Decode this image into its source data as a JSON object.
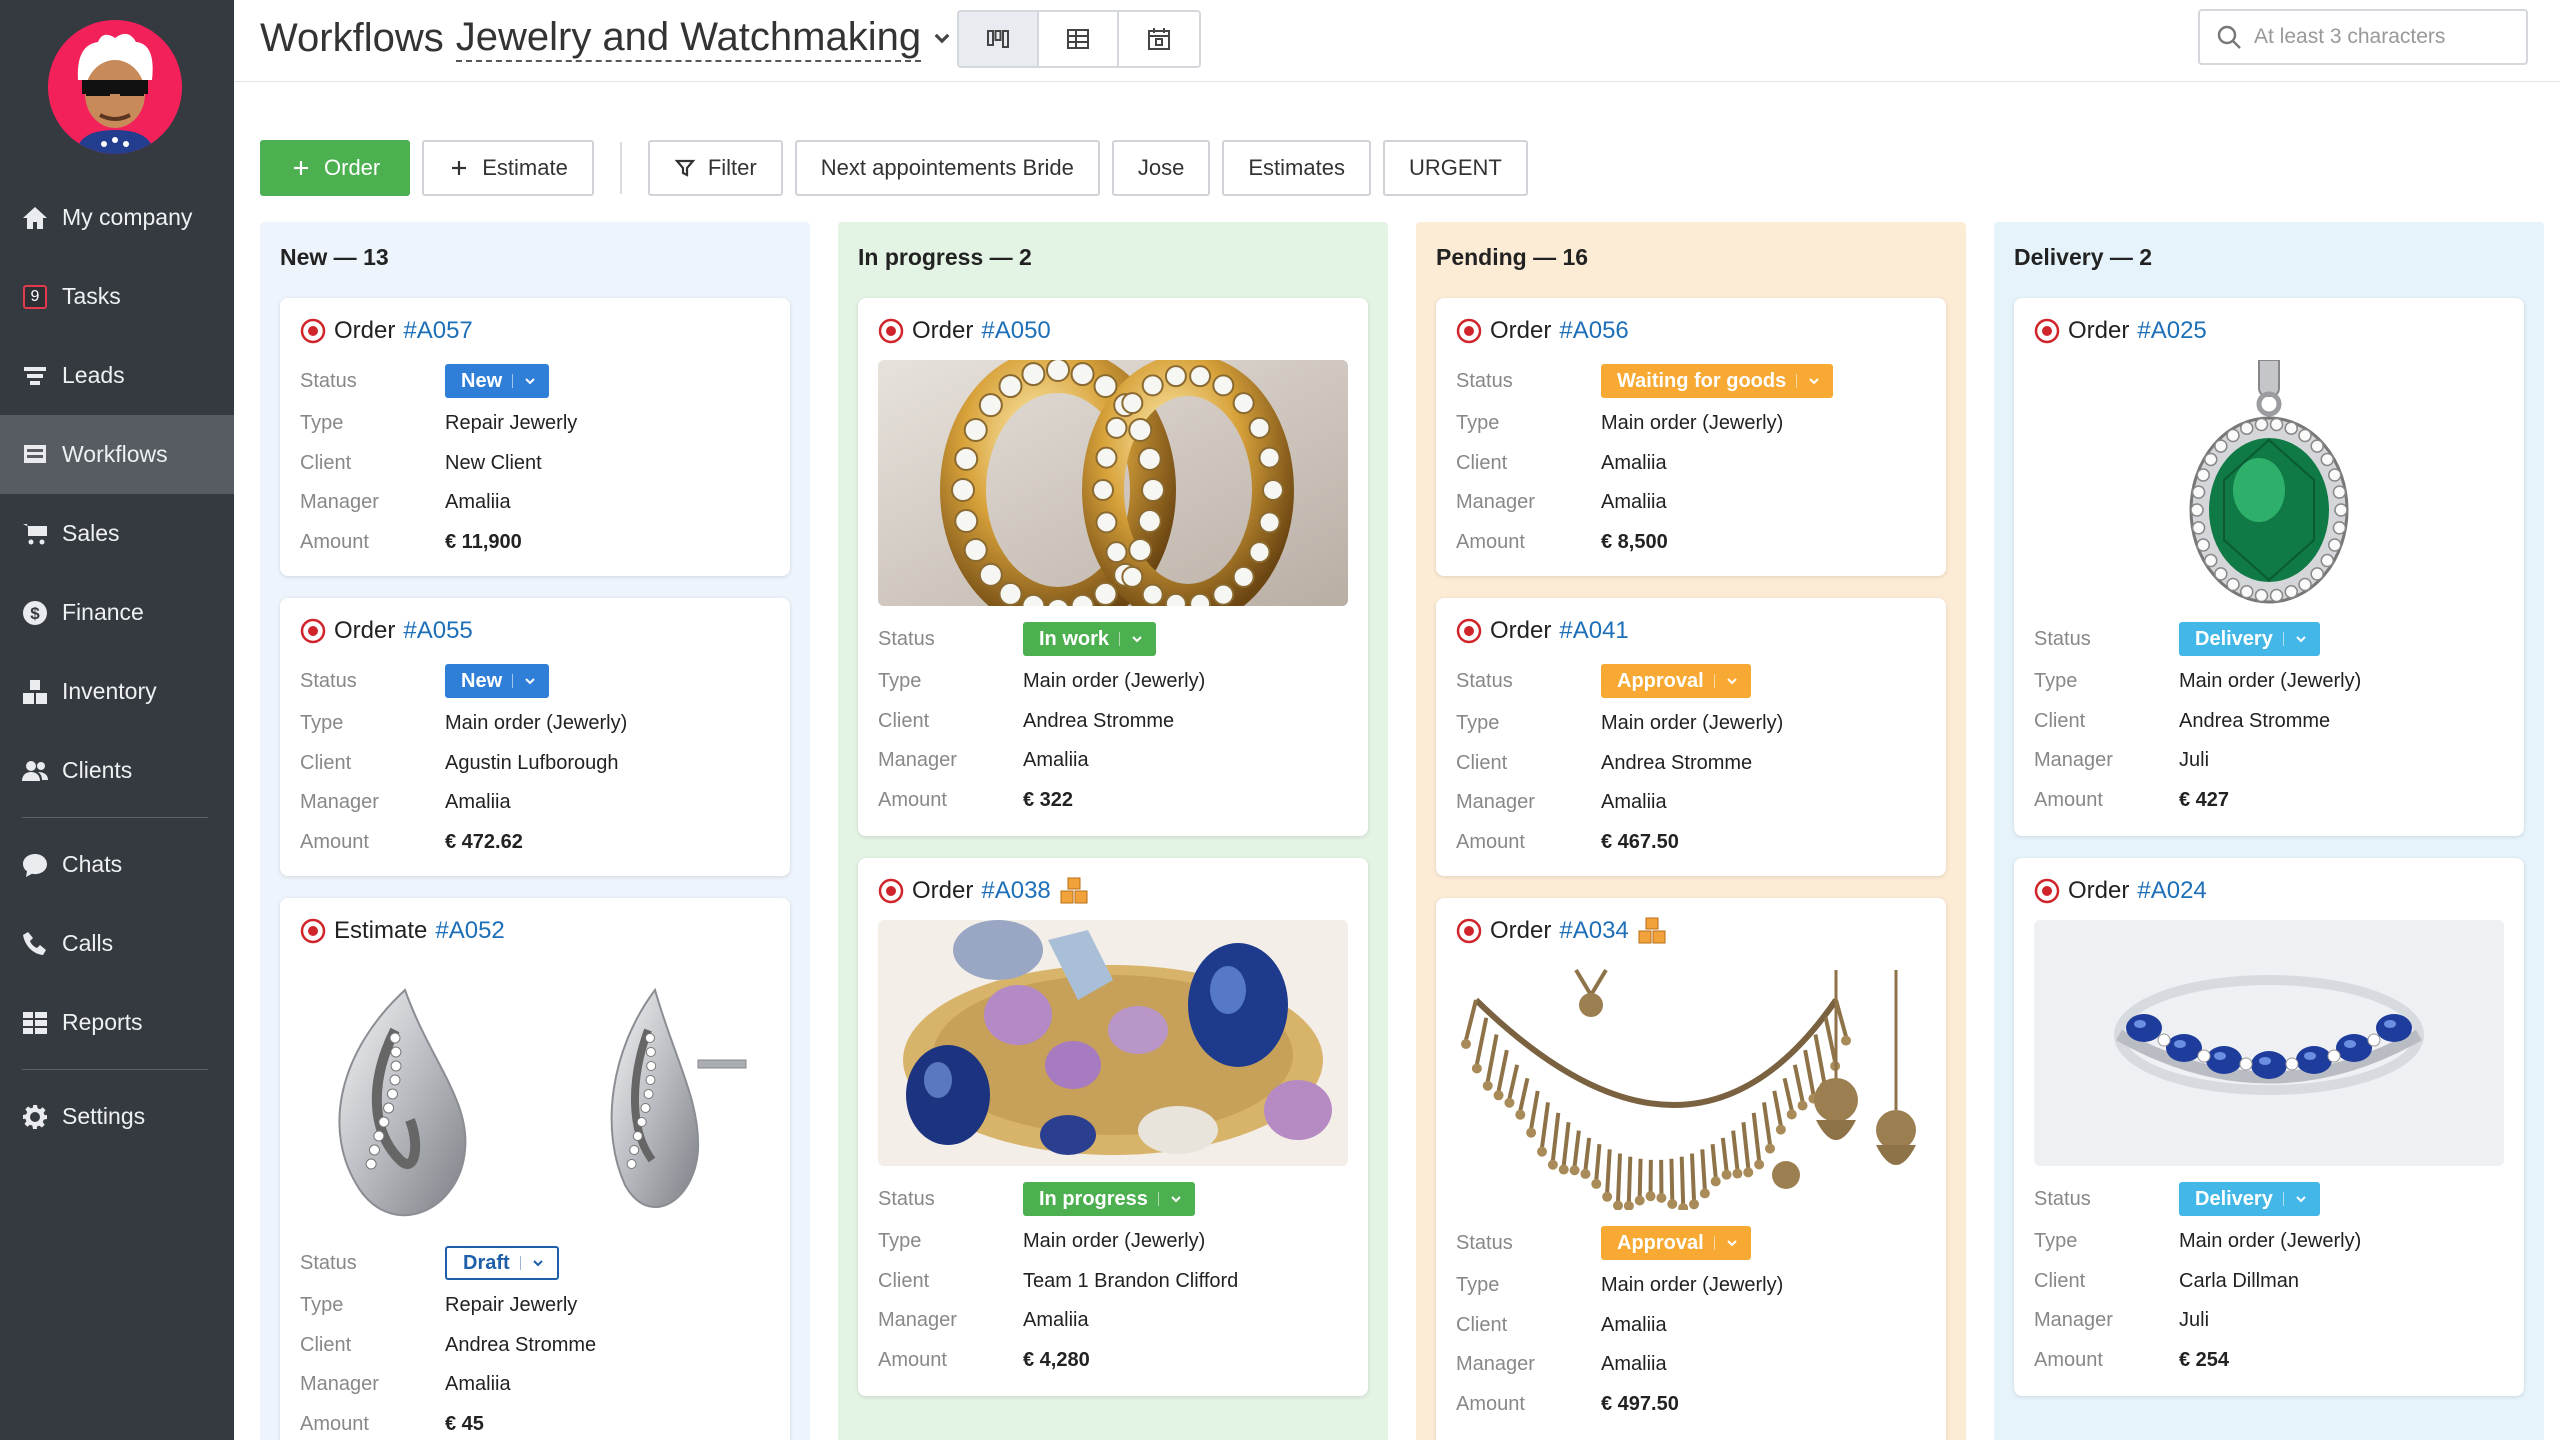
{
  "nav": [
    {
      "label": "My company",
      "icon": "home-icon"
    },
    {
      "label": "Tasks",
      "icon": "tasks-icon",
      "badge": "9"
    },
    {
      "label": "Leads",
      "icon": "funnel-icon"
    },
    {
      "label": "Workflows",
      "icon": "workflows-icon",
      "active": true
    },
    {
      "label": "Sales",
      "icon": "cart-icon"
    },
    {
      "label": "Finance",
      "icon": "dollar-icon"
    },
    {
      "label": "Inventory",
      "icon": "boxes-icon"
    },
    {
      "label": "Clients",
      "icon": "users-icon"
    },
    {
      "label": "Chats",
      "icon": "chat-icon"
    },
    {
      "label": "Calls",
      "icon": "phone-icon"
    },
    {
      "label": "Reports",
      "icon": "grid-icon"
    },
    {
      "label": "Settings",
      "icon": "gear-icon"
    }
  ],
  "header": {
    "title_prefix": "Workflows",
    "title_workflow": "Jewelry and Watchmaking",
    "views": [
      "kanban-icon",
      "table-icon",
      "calendar-icon"
    ],
    "search_placeholder": "At least 3 characters"
  },
  "actions": {
    "order": "Order",
    "estimate": "Estimate",
    "filter": "Filter",
    "presets": [
      "Next appointements Bride",
      "Jose",
      "Estimates",
      "URGENT"
    ]
  },
  "labels": {
    "status": "Status",
    "type": "Type",
    "client": "Client",
    "manager": "Manager",
    "amount": "Amount"
  },
  "colors": {
    "new_bg": "#edf4fb",
    "progress_bg": "#e3f3e4",
    "pending_bg": "#fdecd5",
    "delivery_bg": "#e6f3fb",
    "link": "#1d6fb8",
    "primary": "#4caf50"
  },
  "columns": [
    {
      "title": "New — 13",
      "cards": [
        {
          "kind": "Order",
          "number": "#A057",
          "status": "New",
          "type": "Repair Jewerly",
          "client": "New Client",
          "manager": "Amaliia",
          "amount": "€ 11,900"
        },
        {
          "kind": "Order",
          "number": "#A055",
          "status": "New",
          "type": "Main order (Jewerly)",
          "client": "Agustin Lufborough",
          "manager": "Amaliia",
          "amount": "€ 472.62"
        },
        {
          "kind": "Estimate",
          "number": "#A052",
          "status": "Draft",
          "type": "Repair Jewerly",
          "client": "Andrea Stromme",
          "manager": "Amaliia",
          "amount": "€ 45",
          "image": "earrings-image"
        }
      ]
    },
    {
      "title": "In progress — 2",
      "cards": [
        {
          "kind": "Order",
          "number": "#A050",
          "status": "In work",
          "type": "Main order (Jewerly)",
          "client": "Andrea Stromme",
          "manager": "Amaliia",
          "amount": "€ 322",
          "image": "gold-rings-image"
        },
        {
          "kind": "Order",
          "number": "#A038",
          "status": "In progress",
          "type": "Main order (Jewerly)",
          "client": "Team 1 Brandon Clifford",
          "manager": "Amaliia",
          "amount": "€ 4,280",
          "image": "gemstone-rings-image",
          "flag": "stack-icon"
        }
      ]
    },
    {
      "title": "Pending — 16",
      "cards": [
        {
          "kind": "Order",
          "number": "#A056",
          "status": "Waiting for goods",
          "type": "Main order (Jewerly)",
          "client": "Amaliia",
          "manager": "Amaliia",
          "amount": "€ 8,500"
        },
        {
          "kind": "Order",
          "number": "#A041",
          "status": "Approval",
          "type": "Main order (Jewerly)",
          "client": "Andrea Stromme",
          "manager": "Amaliia",
          "amount": "€ 467.50"
        },
        {
          "kind": "Order",
          "number": "#A034",
          "status": "Approval",
          "type": "Main order (Jewerly)",
          "client": "Amaliia",
          "manager": "Amaliia",
          "amount": "€ 497.50",
          "image": "necklace-set-image",
          "flag": "stack-icon"
        }
      ]
    },
    {
      "title": "Delivery — 2",
      "cards": [
        {
          "kind": "Order",
          "number": "#A025",
          "status": "Delivery",
          "type": "Main order (Jewerly)",
          "client": "Andrea Stromme",
          "manager": "Juli",
          "amount": "€ 427",
          "image": "emerald-pendant-image"
        },
        {
          "kind": "Order",
          "number": "#A024",
          "status": "Delivery",
          "type": "Main order (Jewerly)",
          "client": "Carla Dillman",
          "manager": "Juli",
          "amount": "€ 254",
          "image": "sapphire-ring-image"
        }
      ]
    }
  ]
}
